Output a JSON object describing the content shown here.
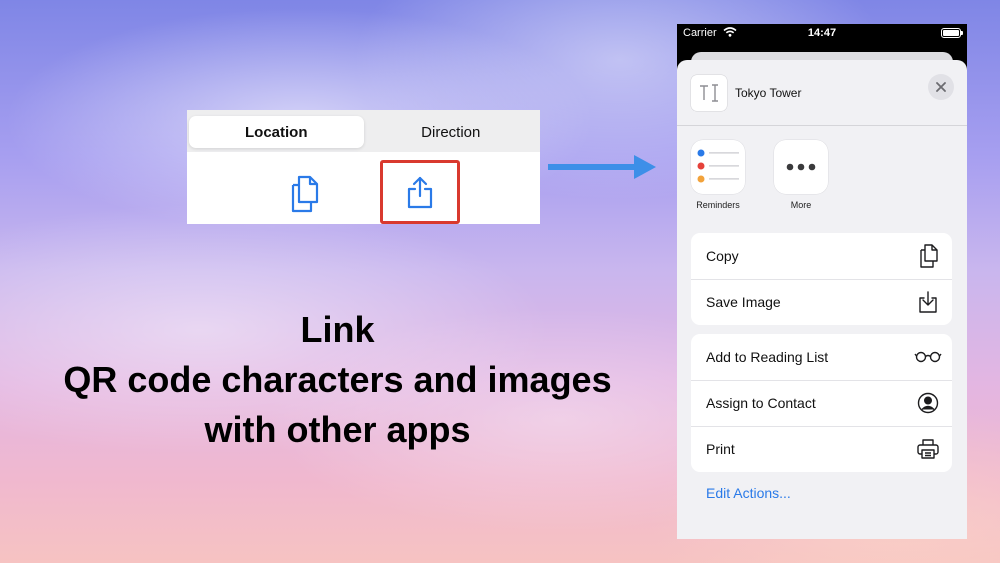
{
  "segmented": {
    "tabs": [
      {
        "label": "Location",
        "active": true
      },
      {
        "label": "Direction",
        "active": false
      }
    ],
    "icons": [
      "copy-docs-icon",
      "share-icon"
    ],
    "highlight_color": "#d9392e",
    "icon_color": "#2a7ae8"
  },
  "caption": {
    "line1": "Link",
    "line2": "QR code characters and images",
    "line3": "with other apps"
  },
  "arrow_color": "#3d8fe8",
  "phone": {
    "status": {
      "carrier": "Carrier",
      "time": "14:47"
    },
    "sheet": {
      "title": "Tokyo Tower",
      "apps": [
        {
          "label": "Reminders",
          "icon": "reminders-icon"
        },
        {
          "label": "More",
          "icon": "more-icon"
        }
      ],
      "group1": [
        {
          "label": "Copy",
          "icon": "copy-icon"
        },
        {
          "label": "Save Image",
          "icon": "save-image-icon"
        }
      ],
      "group2": [
        {
          "label": "Add to Reading List",
          "icon": "glasses-icon"
        },
        {
          "label": "Assign to Contact",
          "icon": "contact-icon"
        },
        {
          "label": "Print",
          "icon": "printer-icon"
        }
      ],
      "edit_actions": "Edit Actions..."
    }
  }
}
